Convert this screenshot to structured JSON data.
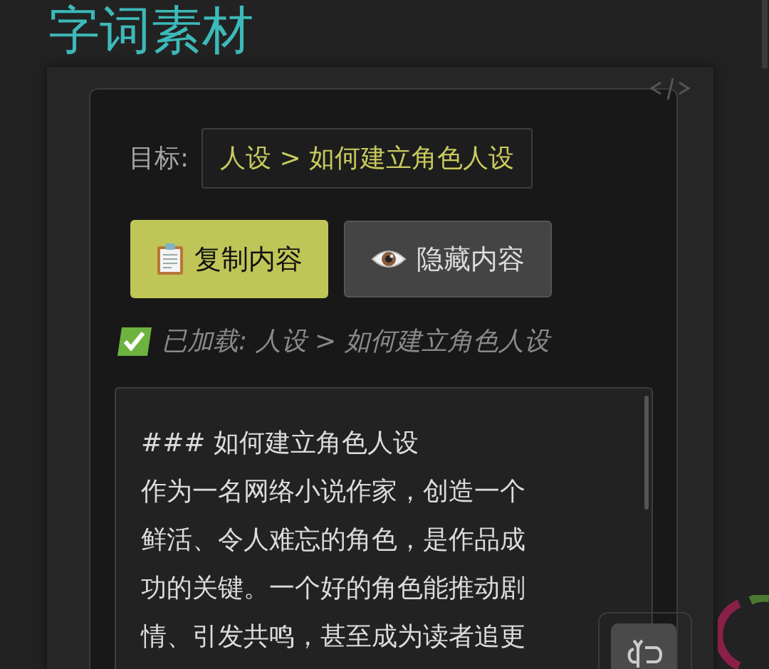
{
  "title": "字词素材",
  "target": {
    "label": "目标:",
    "value": "人设 > 如何建立角色人设"
  },
  "buttons": [
    {
      "label": "复制内容",
      "kind": "primary"
    },
    {
      "label": "隐藏内容",
      "kind": "secondary"
    }
  ],
  "status": "已加载: 人设 > 如何建立角色人设",
  "editor": {
    "lines": [
      "### 如何建立角色人设",
      "作为一名网络小说作家，创造一个",
      "鲜活、令人难忘的角色，是作品成",
      "功的关键。一个好的角色能推动剧",
      "情、引发共鸣，甚至成为读者追更"
    ]
  }
}
